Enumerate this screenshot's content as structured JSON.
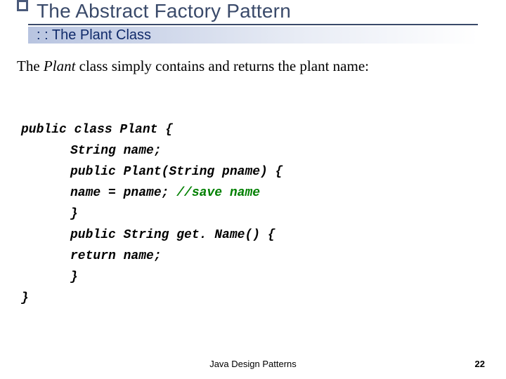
{
  "header": {
    "title": "The Abstract Factory Pattern",
    "subtitle": ": : The Plant Class"
  },
  "body": {
    "intro_pre": "The ",
    "intro_em": "Plant",
    "intro_post": " class simply contains and returns the plant name:"
  },
  "code": {
    "l1": "public class Plant {",
    "l2": "String name;",
    "l3": "public Plant(String pname) {",
    "l4a": "name = pname; ",
    "l4b": "//save name",
    "l5": "}",
    "l6": "public String get. Name() {",
    "l7": "return name;",
    "l8": "}",
    "l9": "}"
  },
  "footer": {
    "center": "Java Design Patterns",
    "page": "22"
  }
}
